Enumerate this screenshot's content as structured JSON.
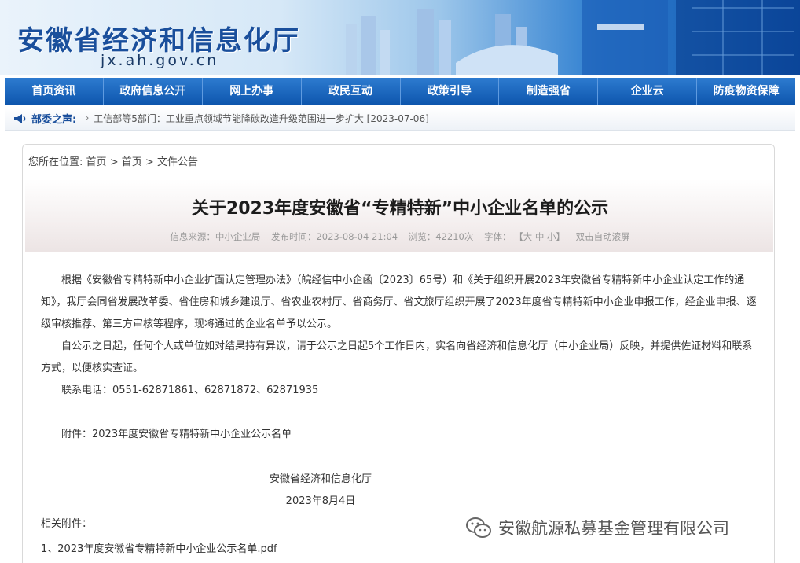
{
  "header": {
    "site_title": "安徽省经济和信息化厅",
    "site_domain": "jx.ah.gov.cn"
  },
  "nav": {
    "items": [
      {
        "label": "首页资讯"
      },
      {
        "label": "政府信息公开"
      },
      {
        "label": "网上办事"
      },
      {
        "label": "政民互动"
      },
      {
        "label": "政策引导"
      },
      {
        "label": "制造强省"
      },
      {
        "label": "企业云"
      },
      {
        "label": "防疫物资保障"
      }
    ]
  },
  "ticker": {
    "label": "部委之声:",
    "text": "工信部等5部门：工业重点领域节能降碳改造升级范围进一步扩大 [2023-07-06]"
  },
  "breadcrumb": {
    "prefix": "您所在位置:",
    "items": [
      "首页",
      "首页",
      "文件公告"
    ],
    "separator": ">"
  },
  "article": {
    "title": "关于2023年度安徽省“专精特新”中小企业名单的公示",
    "meta": {
      "source": "信息来源：中小企业局",
      "date": "发布时间：2023-08-04 21:04",
      "views": "浏览：42210次",
      "font_label": "字体：",
      "font_sizes": "【大 中 小】",
      "autoscroll": "双击自动滚屏"
    },
    "paragraphs": [
      "根据《安徽省专精特新中小企业扩面认定管理办法》（皖经信中小企函〔2023〕65号）和《关于组织开展2023年安徽省专精特新中小企业认定工作的通知》，我厅会同省发展改革委、省住房和城乡建设厅、省农业农村厅、省商务厅、省文旅厅组织开展了2023年度省专精特新中小企业申报工作，经企业申报、逐级审核推荐、第三方审核等程序，现将通过的企业名单予以公示。",
      "自公示之日起，任何个人或单位如对结果持有异议，请于公示之日起5个工作日内，实名向省经济和信息化厅（中小企业局）反映，并提供佐证材料和联系方式，以便核实查证。",
      "联系电话：0551-62871861、62871872、62871935"
    ],
    "attachment_note": "附件：2023年度安徽省专精特新中小企业公示名单",
    "signature_org": "安徽省经济和信息化厅",
    "signature_date": "2023年8月4日",
    "related_label": "相关附件：",
    "related_file": "1、2023年度安徽省专精特新中小企业公示名单.pdf"
  },
  "watermark": {
    "text": "安徽航源私募基金管理有限公司"
  }
}
